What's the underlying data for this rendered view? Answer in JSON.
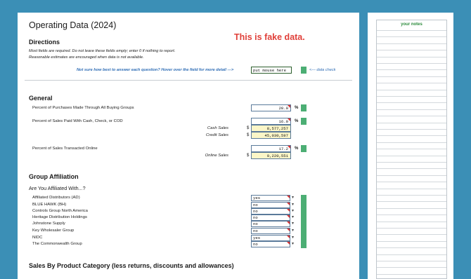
{
  "page": {
    "title": "Operating Data (2024)",
    "banner": "This is fake data."
  },
  "directions": {
    "heading": "Directions",
    "line1": "Most fields are required.  Do not leave these fields empty; enter 0 if nothing to report.",
    "line2": "Reasonable estimates are encouraged when data is not available.",
    "help": "Not sure how best to answer each question? Hover over the field for more detail --->",
    "help_input": "put mouse here",
    "data_check": "<--- data check"
  },
  "general": {
    "heading": "General",
    "buying_groups": {
      "label": "Percent of Purchases Made Through All Buying Groups",
      "value": "20.0",
      "unit": "%"
    },
    "cash_sales_pct": {
      "label": "Percent of Sales Paid With Cash, Check, or COD",
      "value": "16.0",
      "unit": "%"
    },
    "cash_sales": {
      "label": "Cash Sales",
      "currency": "$",
      "value": "8,577,257"
    },
    "credit_sales": {
      "label": "Credit Sales",
      "currency": "$",
      "value": "45,030,597"
    },
    "online_pct": {
      "label": "Percent of Sales Transacted Online",
      "value": "17.2",
      "unit": "%"
    },
    "online_sales": {
      "label": "Online Sales",
      "currency": "$",
      "value": "9,220,551"
    }
  },
  "group_affiliation": {
    "heading": "Group Affiliation",
    "question": "Are You Affiliated With...?",
    "items": [
      {
        "label": "Affiliated Distributors (AD)",
        "value": "yes"
      },
      {
        "label": "BLUE HAWK (BH)",
        "value": "no"
      },
      {
        "label": "Controls Group North America",
        "value": "no"
      },
      {
        "label": "Heritage Distribution Holdings",
        "value": "no"
      },
      {
        "label": "Johnstone Supply",
        "value": "no"
      },
      {
        "label": "Key Wholesaler Group",
        "value": "no"
      },
      {
        "label": "NIDC",
        "value": "yes"
      },
      {
        "label": "The Commonwealth Group",
        "value": "no"
      }
    ]
  },
  "sales_by_category": {
    "heading": "Sales By Product Category (less returns, discounts and allowances)"
  },
  "notes": {
    "title": "your notes"
  },
  "colors": {
    "background": "#3b8fb6",
    "check_green": "#4cae74",
    "banner_red": "#e0403a",
    "help_blue": "#2f6db5",
    "computed_yellow": "#fbf6c8"
  }
}
